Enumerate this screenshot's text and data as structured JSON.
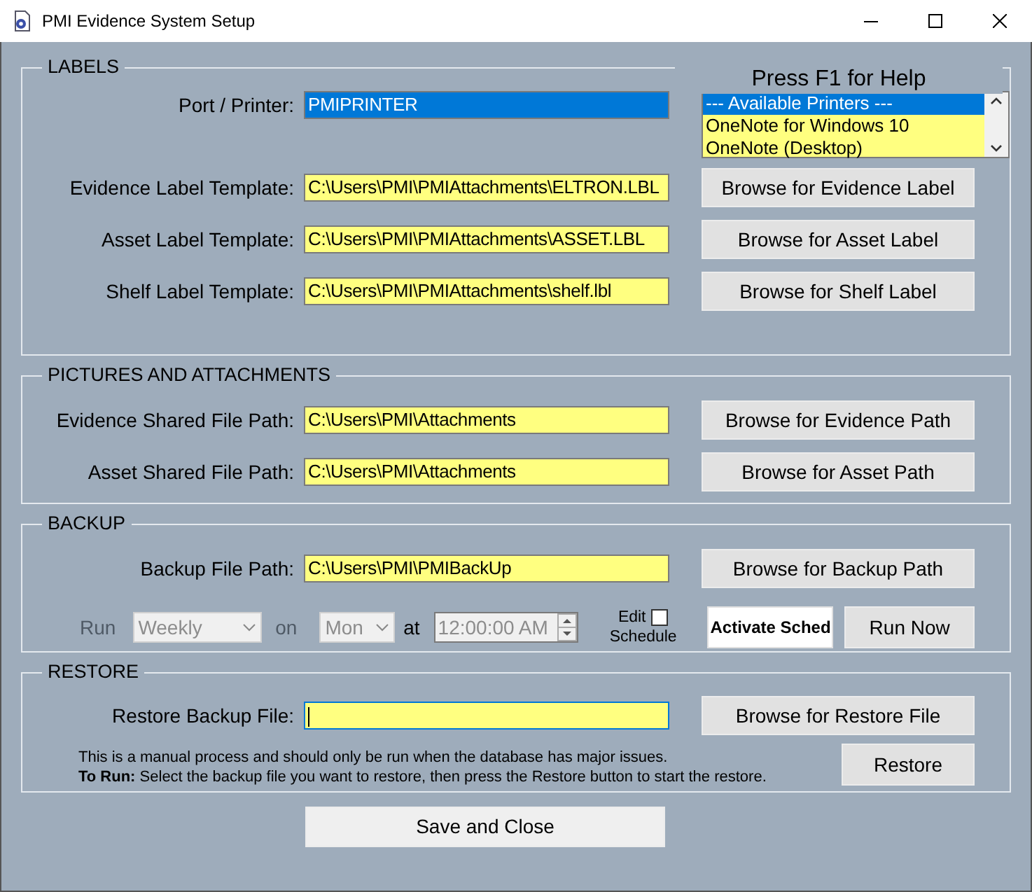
{
  "window": {
    "title": "PMI Evidence System Setup"
  },
  "help_text": "Press F1 for Help",
  "labels": {
    "title": "LABELS",
    "port": {
      "label": "Port / Printer:",
      "value": "PMIPRINTER",
      "selected": true
    },
    "printers": [
      {
        "text": "--- Available Printers ---",
        "selected": true
      },
      {
        "text": "OneNote for Windows 10",
        "selected": false
      },
      {
        "text": "OneNote (Desktop)",
        "selected": false
      }
    ],
    "templates": [
      {
        "label": "Evidence Label Template:",
        "value": "C:\\Users\\PMI\\PMIAttachments\\ELTRON.LBL",
        "button": "Browse for Evidence Label"
      },
      {
        "label": "Asset Label Template:",
        "value": "C:\\Users\\PMI\\PMIAttachments\\ASSET.LBL",
        "button": "Browse for Asset Label"
      },
      {
        "label": "Shelf Label Template:",
        "value": "C:\\Users\\PMI\\PMIAttachments\\shelf.lbl",
        "button": "Browse for Shelf Label"
      }
    ]
  },
  "pictures": {
    "title": "PICTURES AND ATTACHMENTS",
    "paths": [
      {
        "label": "Evidence Shared File Path:",
        "value": "C:\\Users\\PMI\\Attachments",
        "button": "Browse for Evidence Path"
      },
      {
        "label": "Asset Shared File Path:",
        "value": "C:\\Users\\PMI\\Attachments",
        "button": "Browse for Asset Path"
      }
    ]
  },
  "backup": {
    "title": "BACKUP",
    "path": {
      "label": "Backup File Path:",
      "value": "C:\\Users\\PMI\\PMIBackUp",
      "button": "Browse for Backup Path"
    },
    "schedule": {
      "disabled": true,
      "run_label": "Run",
      "frequency": "Weekly",
      "on_label": "on",
      "day": "Mon",
      "at_label": "at",
      "time": "12:00:00 AM",
      "edit_label": "Edit",
      "schedule_label": "Schedule",
      "edit_checked": false
    },
    "buttons": [
      {
        "label": "Activate Sched",
        "kind": "emphasized"
      },
      {
        "label": "Run Now",
        "kind": "normal"
      }
    ]
  },
  "restore": {
    "title": "RESTORE",
    "field": {
      "label": "Restore Backup File:",
      "focused": true
    },
    "button": "Browse for Restore File",
    "notes": [
      "This is a manual process and should only be run when the database has major issues.",
      "**To Run:**  Select the backup file you want to restore, then press the Restore button to start the restore."
    ],
    "restore_button": "Restore"
  },
  "save_button": "Save and Close"
}
